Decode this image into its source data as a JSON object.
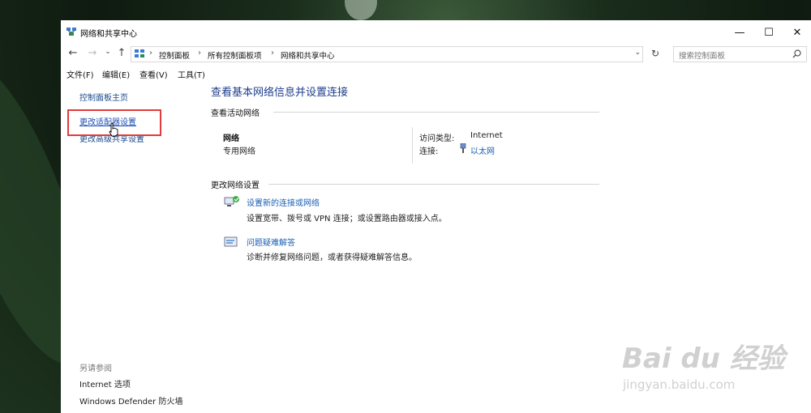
{
  "window": {
    "title": "网络和共享中心",
    "controls": {
      "minimize": "—",
      "maximize": "☐",
      "close": "✕"
    }
  },
  "nav": {
    "back": "←",
    "forward": "→",
    "dropdown": "⌄",
    "up": "↑"
  },
  "address": {
    "crumbs": [
      "控制面板",
      "所有控制面板项",
      "网络和共享中心"
    ],
    "separator": "›",
    "refresh": "↻",
    "search_placeholder": "搜索控制面板"
  },
  "menu": [
    "文件(F)",
    "编辑(E)",
    "查看(V)",
    "工具(T)"
  ],
  "sidebar": {
    "home": "控制面板主页",
    "adapter": "更改适配器设置",
    "advanced": "更改高级共享设置",
    "see_also_title": "另请参阅",
    "see_also": [
      "Internet 选项",
      "Windows Defender 防火墙"
    ]
  },
  "main": {
    "title": "查看基本网络信息并设置连接",
    "active_section": "查看活动网络",
    "network": {
      "name": "网络",
      "type": "专用网络",
      "access_label": "访问类型:",
      "access_value": "Internet",
      "connection_label": "连接:",
      "connection_value": "以太网"
    },
    "change_section": "更改网络设置",
    "tasks": [
      {
        "icon": "network-setup-icon",
        "link": "设置新的连接或网络",
        "desc": "设置宽带、拨号或 VPN 连接；或设置路由器或接入点。"
      },
      {
        "icon": "troubleshoot-icon",
        "link": "问题疑难解答",
        "desc": "诊断并修复网络问题，或者获得疑难解答信息。"
      }
    ]
  },
  "watermark": {
    "brand": "Bai du 经验",
    "url": "jingyan.baidu.com"
  },
  "colors": {
    "link": "#1a5fb4",
    "title": "#1e3e8c",
    "highlight_box": "#e23b3b"
  }
}
